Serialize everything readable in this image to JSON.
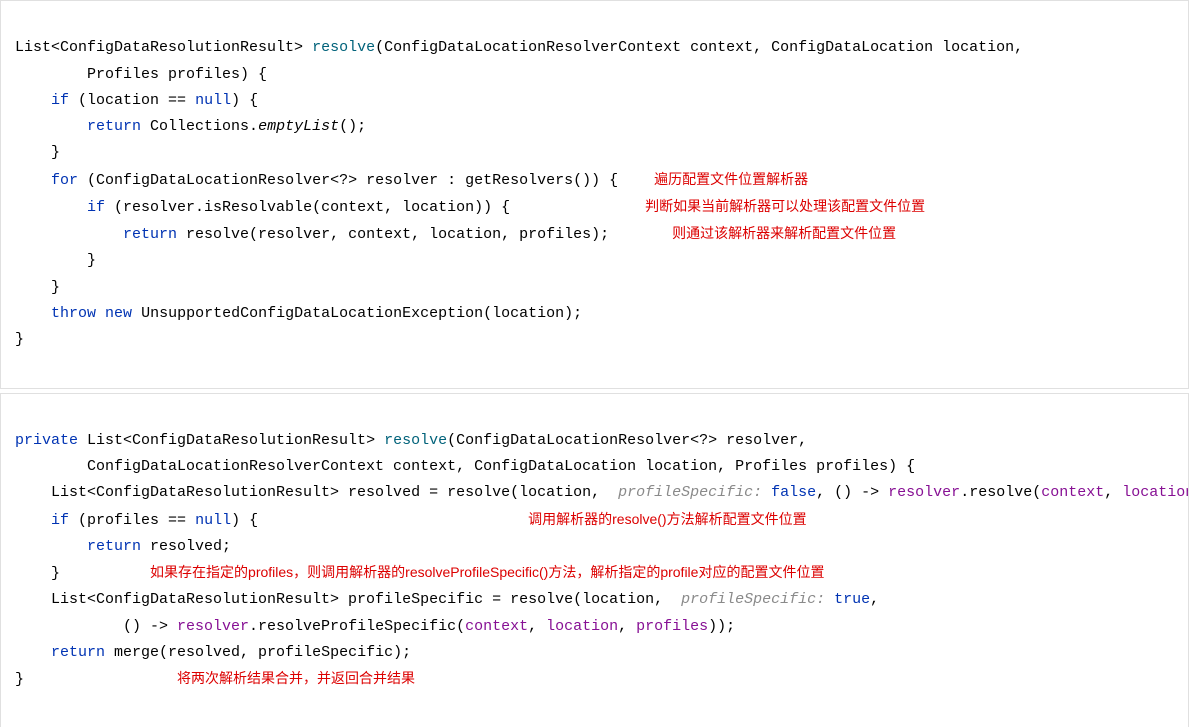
{
  "block1": {
    "l1_a": "List<ConfigDataResolutionResult> ",
    "l1_m": "resolve",
    "l1_b": "(ConfigDataLocationResolverContext context, ConfigDataLocation location,",
    "l2": "        Profiles profiles) {",
    "l3_a": "    ",
    "l3_kw": "if",
    "l3_b": " (location == ",
    "l3_null": "null",
    "l3_c": ") {",
    "l4_a": "        ",
    "l4_kw": "return",
    "l4_b": " Collections.",
    "l4_em": "emptyList",
    "l4_c": "();",
    "l5": "    }",
    "l6_a": "    ",
    "l6_kw": "for",
    "l6_b": " (ConfigDataLocationResolver<?> resolver : getResolvers()) {",
    "l7_a": "        ",
    "l7_kw": "if",
    "l7_b": " (resolver.isResolvable(context, location)) {",
    "l8_a": "            ",
    "l8_kw": "return",
    "l8_b": " resolve(resolver, context, location, profiles);",
    "l9": "        }",
    "l10": "    }",
    "l11_a": "    ",
    "l11_throw": "throw",
    "l11_sp": " ",
    "l11_new": "new",
    "l11_b": " UnsupportedConfigDataLocationException(location);",
    "l12": "}",
    "ann1": "遍历配置文件位置解析器",
    "ann2": "判断如果当前解析器可以处理该配置文件位置",
    "ann3": "则通过该解析器来解析配置文件位置"
  },
  "block2": {
    "l1_kw": "private",
    "l1_a": " List<ConfigDataResolutionResult> ",
    "l1_m": "resolve",
    "l1_b": "(ConfigDataLocationResolver<?> resolver,",
    "l2": "        ConfigDataLocationResolverContext context, ConfigDataLocation location, Profiles profiles) {",
    "l3_a": "    List<ConfigDataResolutionResult> resolved = resolve(location, ",
    "l3_hint": " profileSpecific: ",
    "l3_false": "false",
    "l3_b": ", () -> ",
    "l3_rv": "resolver",
    "l3_c": ".resolve(",
    "l3_ctx": "context",
    "l3_d": ", ",
    "l3_loc": "location",
    "l3_e": "));",
    "l4_a": "    ",
    "l4_kw": "if",
    "l4_b": " (profiles == ",
    "l4_null": "null",
    "l4_c": ") {",
    "l5_a": "        ",
    "l5_kw": "return",
    "l5_b": " resolved;",
    "l6": "    }",
    "l7_a": "    List<ConfigDataResolutionResult> profileSpecific = resolve(location, ",
    "l7_hint": " profileSpecific: ",
    "l7_true": "true",
    "l7_b": ",",
    "l8_a": "            () -> ",
    "l8_rv": "resolver",
    "l8_b": ".resolveProfileSpecific(",
    "l8_ctx": "context",
    "l8_c": ", ",
    "l8_loc": "location",
    "l8_d": ", ",
    "l8_prof": "profiles",
    "l8_e": "));",
    "l9_a": "    ",
    "l9_kw": "return",
    "l9_b": " merge(resolved, profileSpecific);",
    "l10": "}",
    "annA": "调用解析器的resolve()方法解析配置文件位置",
    "annB": "如果存在指定的profiles，则调用解析器的resolveProfileSpecific()方法，解析指定的profile对应的配置文件位置",
    "annC": "将两次解析结果合并，并返回合并结果"
  }
}
